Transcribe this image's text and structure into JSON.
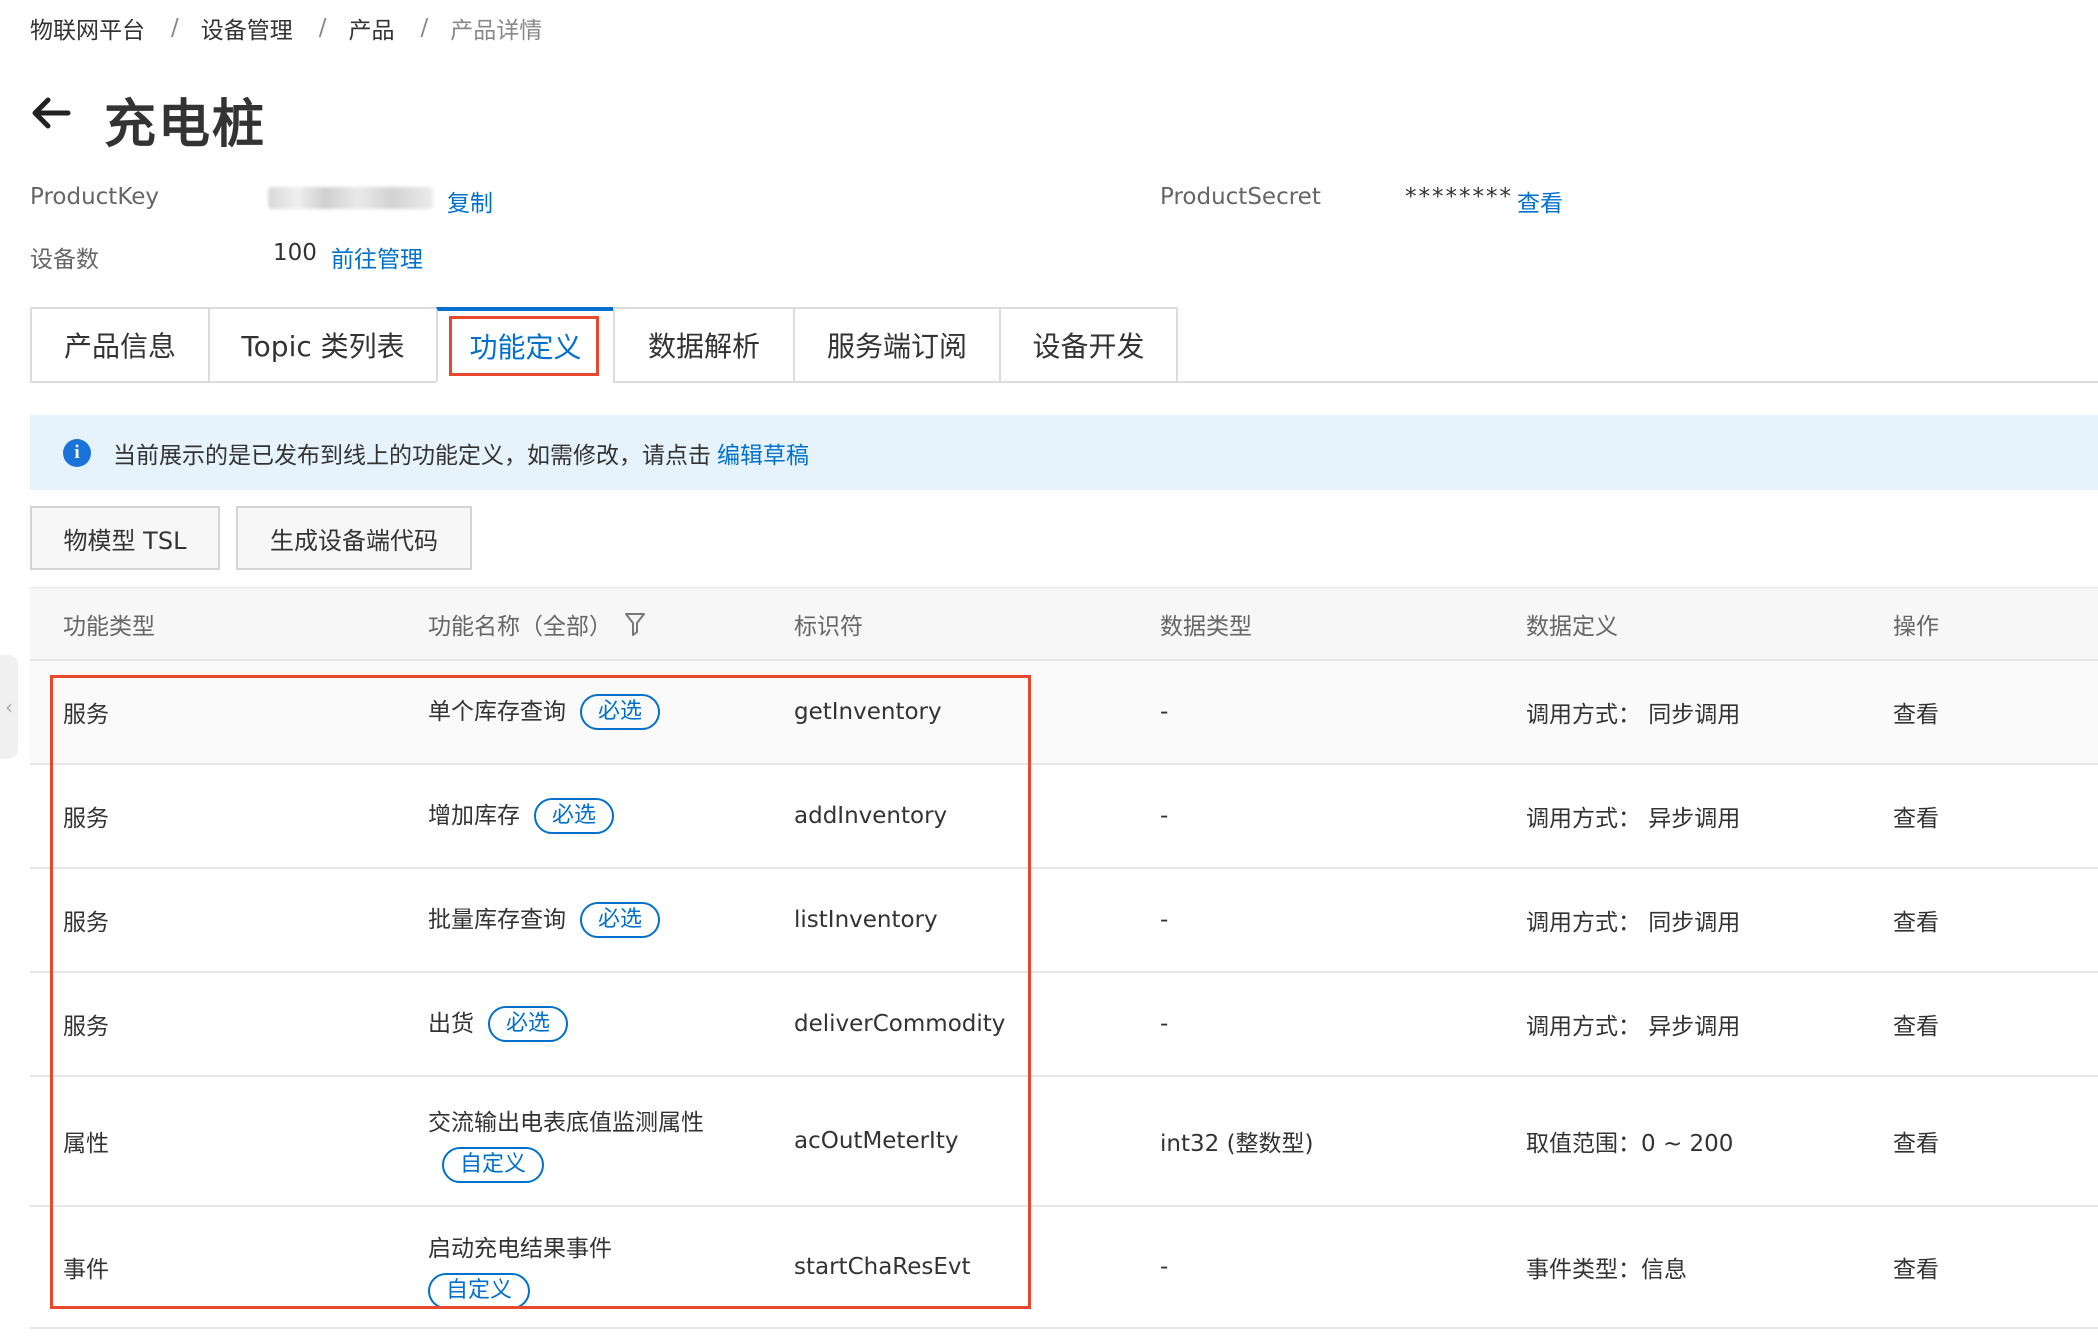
{
  "breadcrumb": {
    "items": [
      "物联网平台",
      "设备管理",
      "产品",
      "产品详情"
    ],
    "separator": "/"
  },
  "header": {
    "title": "充电桩"
  },
  "info": {
    "product_key_label": "ProductKey",
    "copy_link": "复制",
    "product_secret_label": "ProductSecret",
    "product_secret_value": "********",
    "view_link": "查看",
    "device_count_label": "设备数",
    "device_count_value": "100",
    "manage_link": "前往管理"
  },
  "tabs": [
    {
      "label": "产品信息",
      "active": false
    },
    {
      "label": "Topic 类列表",
      "active": false
    },
    {
      "label": "功能定义",
      "active": true
    },
    {
      "label": "数据解析",
      "active": false
    },
    {
      "label": "服务端订阅",
      "active": false
    },
    {
      "label": "设备开发",
      "active": false
    }
  ],
  "notice": {
    "text": "当前展示的是已发布到线上的功能定义，如需修改，请点击",
    "link": "编辑草稿"
  },
  "buttons": {
    "tsl": "物模型 TSL",
    "gen_code": "生成设备端代码"
  },
  "table": {
    "headers": {
      "type": "功能类型",
      "name": "功能名称（全部）",
      "identifier": "标识符",
      "data_type": "数据类型",
      "data_def": "数据定义",
      "op": "操作"
    },
    "rows": [
      {
        "type": "服务",
        "name": "单个库存查询",
        "tag": "必选",
        "identifier": "getInventory",
        "data_type": "-",
        "data_def": "调用方式： 同步调用",
        "op": "查看"
      },
      {
        "type": "服务",
        "name": "增加库存",
        "tag": "必选",
        "identifier": "addInventory",
        "data_type": "-",
        "data_def": "调用方式： 异步调用",
        "op": "查看"
      },
      {
        "type": "服务",
        "name": "批量库存查询",
        "tag": "必选",
        "identifier": "listInventory",
        "data_type": "-",
        "data_def": "调用方式： 同步调用",
        "op": "查看"
      },
      {
        "type": "服务",
        "name": "出货",
        "tag": "必选",
        "identifier": "deliverCommodity",
        "data_type": "-",
        "data_def": "调用方式： 异步调用",
        "op": "查看"
      },
      {
        "type": "属性",
        "name_line1": "交流输出电表底值监测属",
        "name_line2": "性",
        "tag": "自定义",
        "identifier": "acOutMeterIty",
        "data_type": "int32 (整数型)",
        "data_def": "取值范围：0 ~ 200",
        "op": "查看"
      },
      {
        "type": "事件",
        "name": "启动充电结果事件",
        "tag": "自定义",
        "identifier": "startChaResEvt",
        "data_type": "-",
        "data_def": "事件类型：信息",
        "op": "查看"
      }
    ]
  },
  "colors": {
    "link": "#0070cc",
    "highlight": "#e8482e",
    "notice_bg": "#e6f3fd",
    "info_icon": "#1a73d8"
  },
  "icons": {
    "back": "arrow-left-icon",
    "info": "info-icon",
    "filter": "filter-icon",
    "side": "chevron-left-icon"
  }
}
